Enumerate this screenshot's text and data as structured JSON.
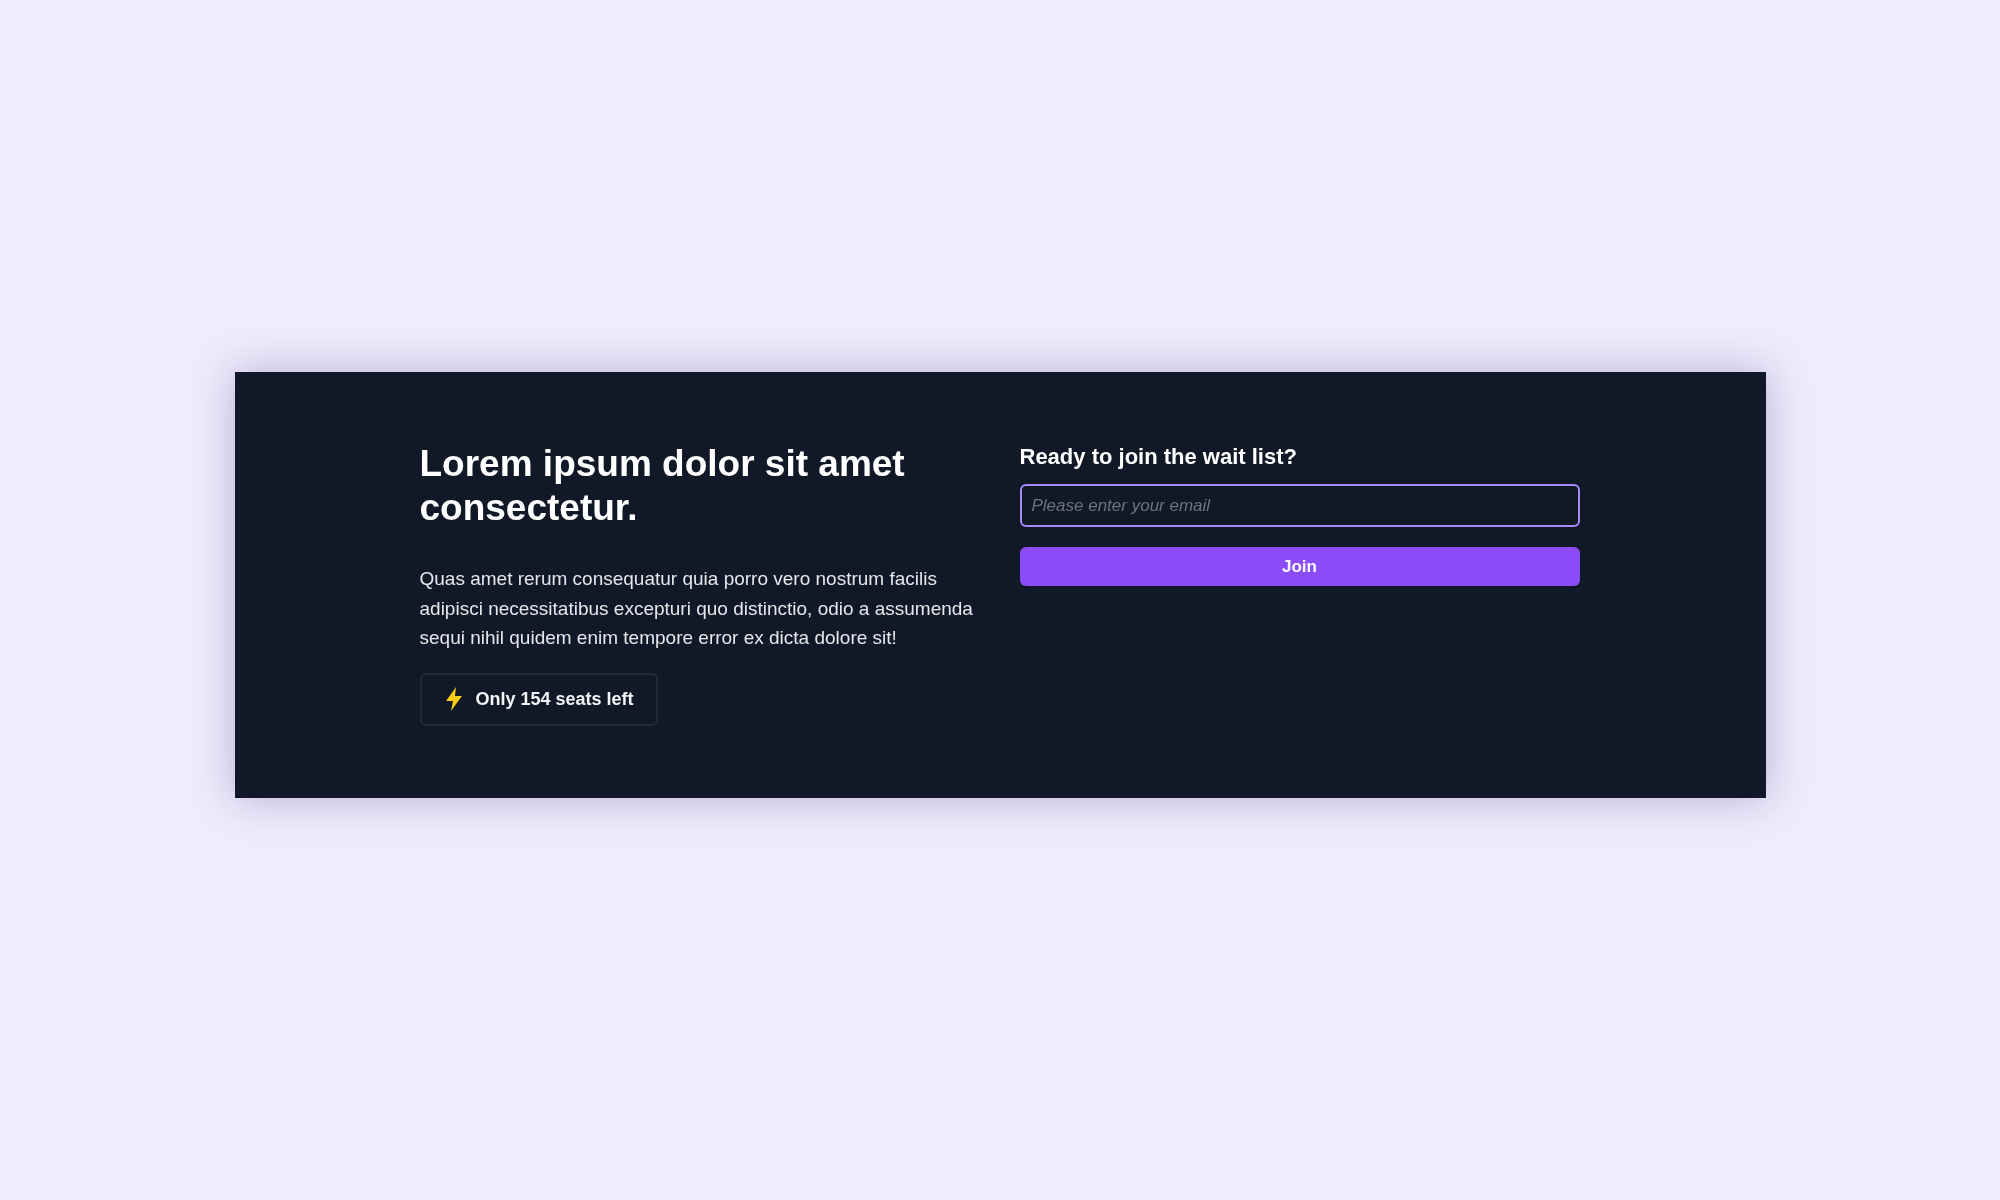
{
  "hero": {
    "title": "Lorem ipsum dolor sit amet consectetur.",
    "body": "Quas amet rerum consequatur quia porro vero nostrum facilis adipisci necessitatibus excepturi quo distinctio, odio a assumenda sequi nihil quidem enim tempore error ex dicta dolore sit!",
    "badge": "Only 154 seats left"
  },
  "signup": {
    "heading": "Ready to join the wait list?",
    "email": {
      "placeholder": "Please enter your email"
    },
    "button": "Join"
  }
}
